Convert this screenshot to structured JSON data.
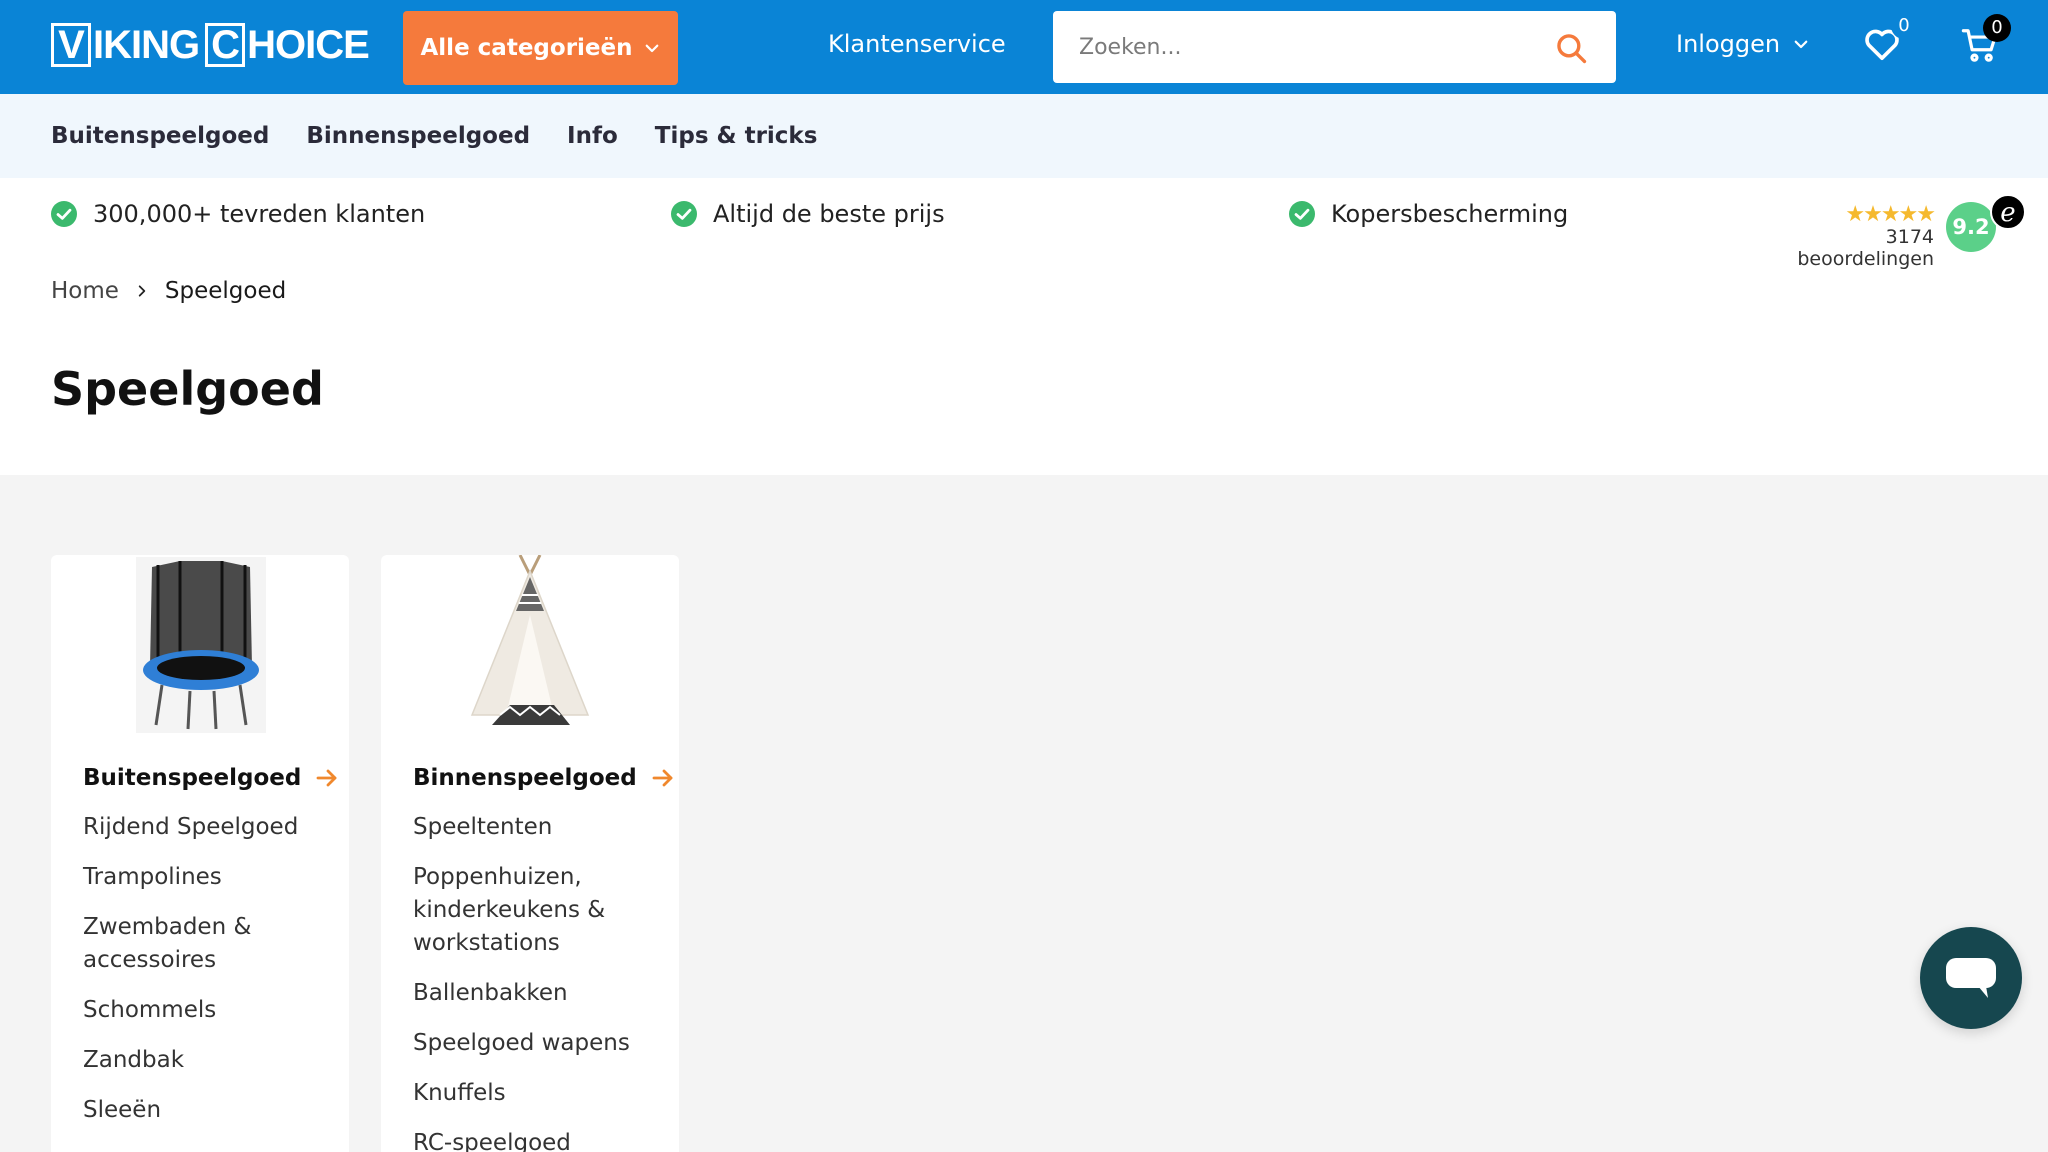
{
  "header": {
    "logo": {
      "part1_box": "V",
      "part1_rest": "IKING",
      "part2_box": "C",
      "part2_rest": "HOICE"
    },
    "categories_label": "Alle categorieën",
    "customer_service": "Klantenservice",
    "search_placeholder": "Zoeken...",
    "login_label": "Inloggen",
    "wishlist_count": "0",
    "cart_count": "0"
  },
  "subnav": [
    "Buitenspeelgoed",
    "Binnenspeelgoed",
    "Info",
    "Tips & tricks"
  ],
  "usps": [
    "300,000+ tevreden klanten",
    "Altijd de beste prijs",
    "Kopersbescherming"
  ],
  "reviews": {
    "stars": "★★★★★",
    "count_label": "3174 beoordelingen",
    "score": "9.2",
    "badge": "e"
  },
  "breadcrumb": {
    "home": "Home",
    "current": "Speelgoed"
  },
  "page_title": "Speelgoed",
  "cards": [
    {
      "title": "Buitenspeelgoed",
      "items": [
        "Rijdend Speelgoed",
        "Trampolines",
        "Zwembaden & accessoires",
        "Schommels",
        "Zandbak",
        "Sleeën"
      ]
    },
    {
      "title": "Binnenspeelgoed",
      "items": [
        "Speeltenten",
        "Poppenhuizen, kinderkeukens & workstations",
        "Ballenbakken",
        "Speelgoed wapens",
        "Knuffels",
        "RC-speelgoed"
      ]
    }
  ],
  "colors": {
    "brand_blue": "#0a84d6",
    "accent_orange": "#f57a3c",
    "score_green": "#5bd089",
    "chat_teal": "#16474f"
  }
}
